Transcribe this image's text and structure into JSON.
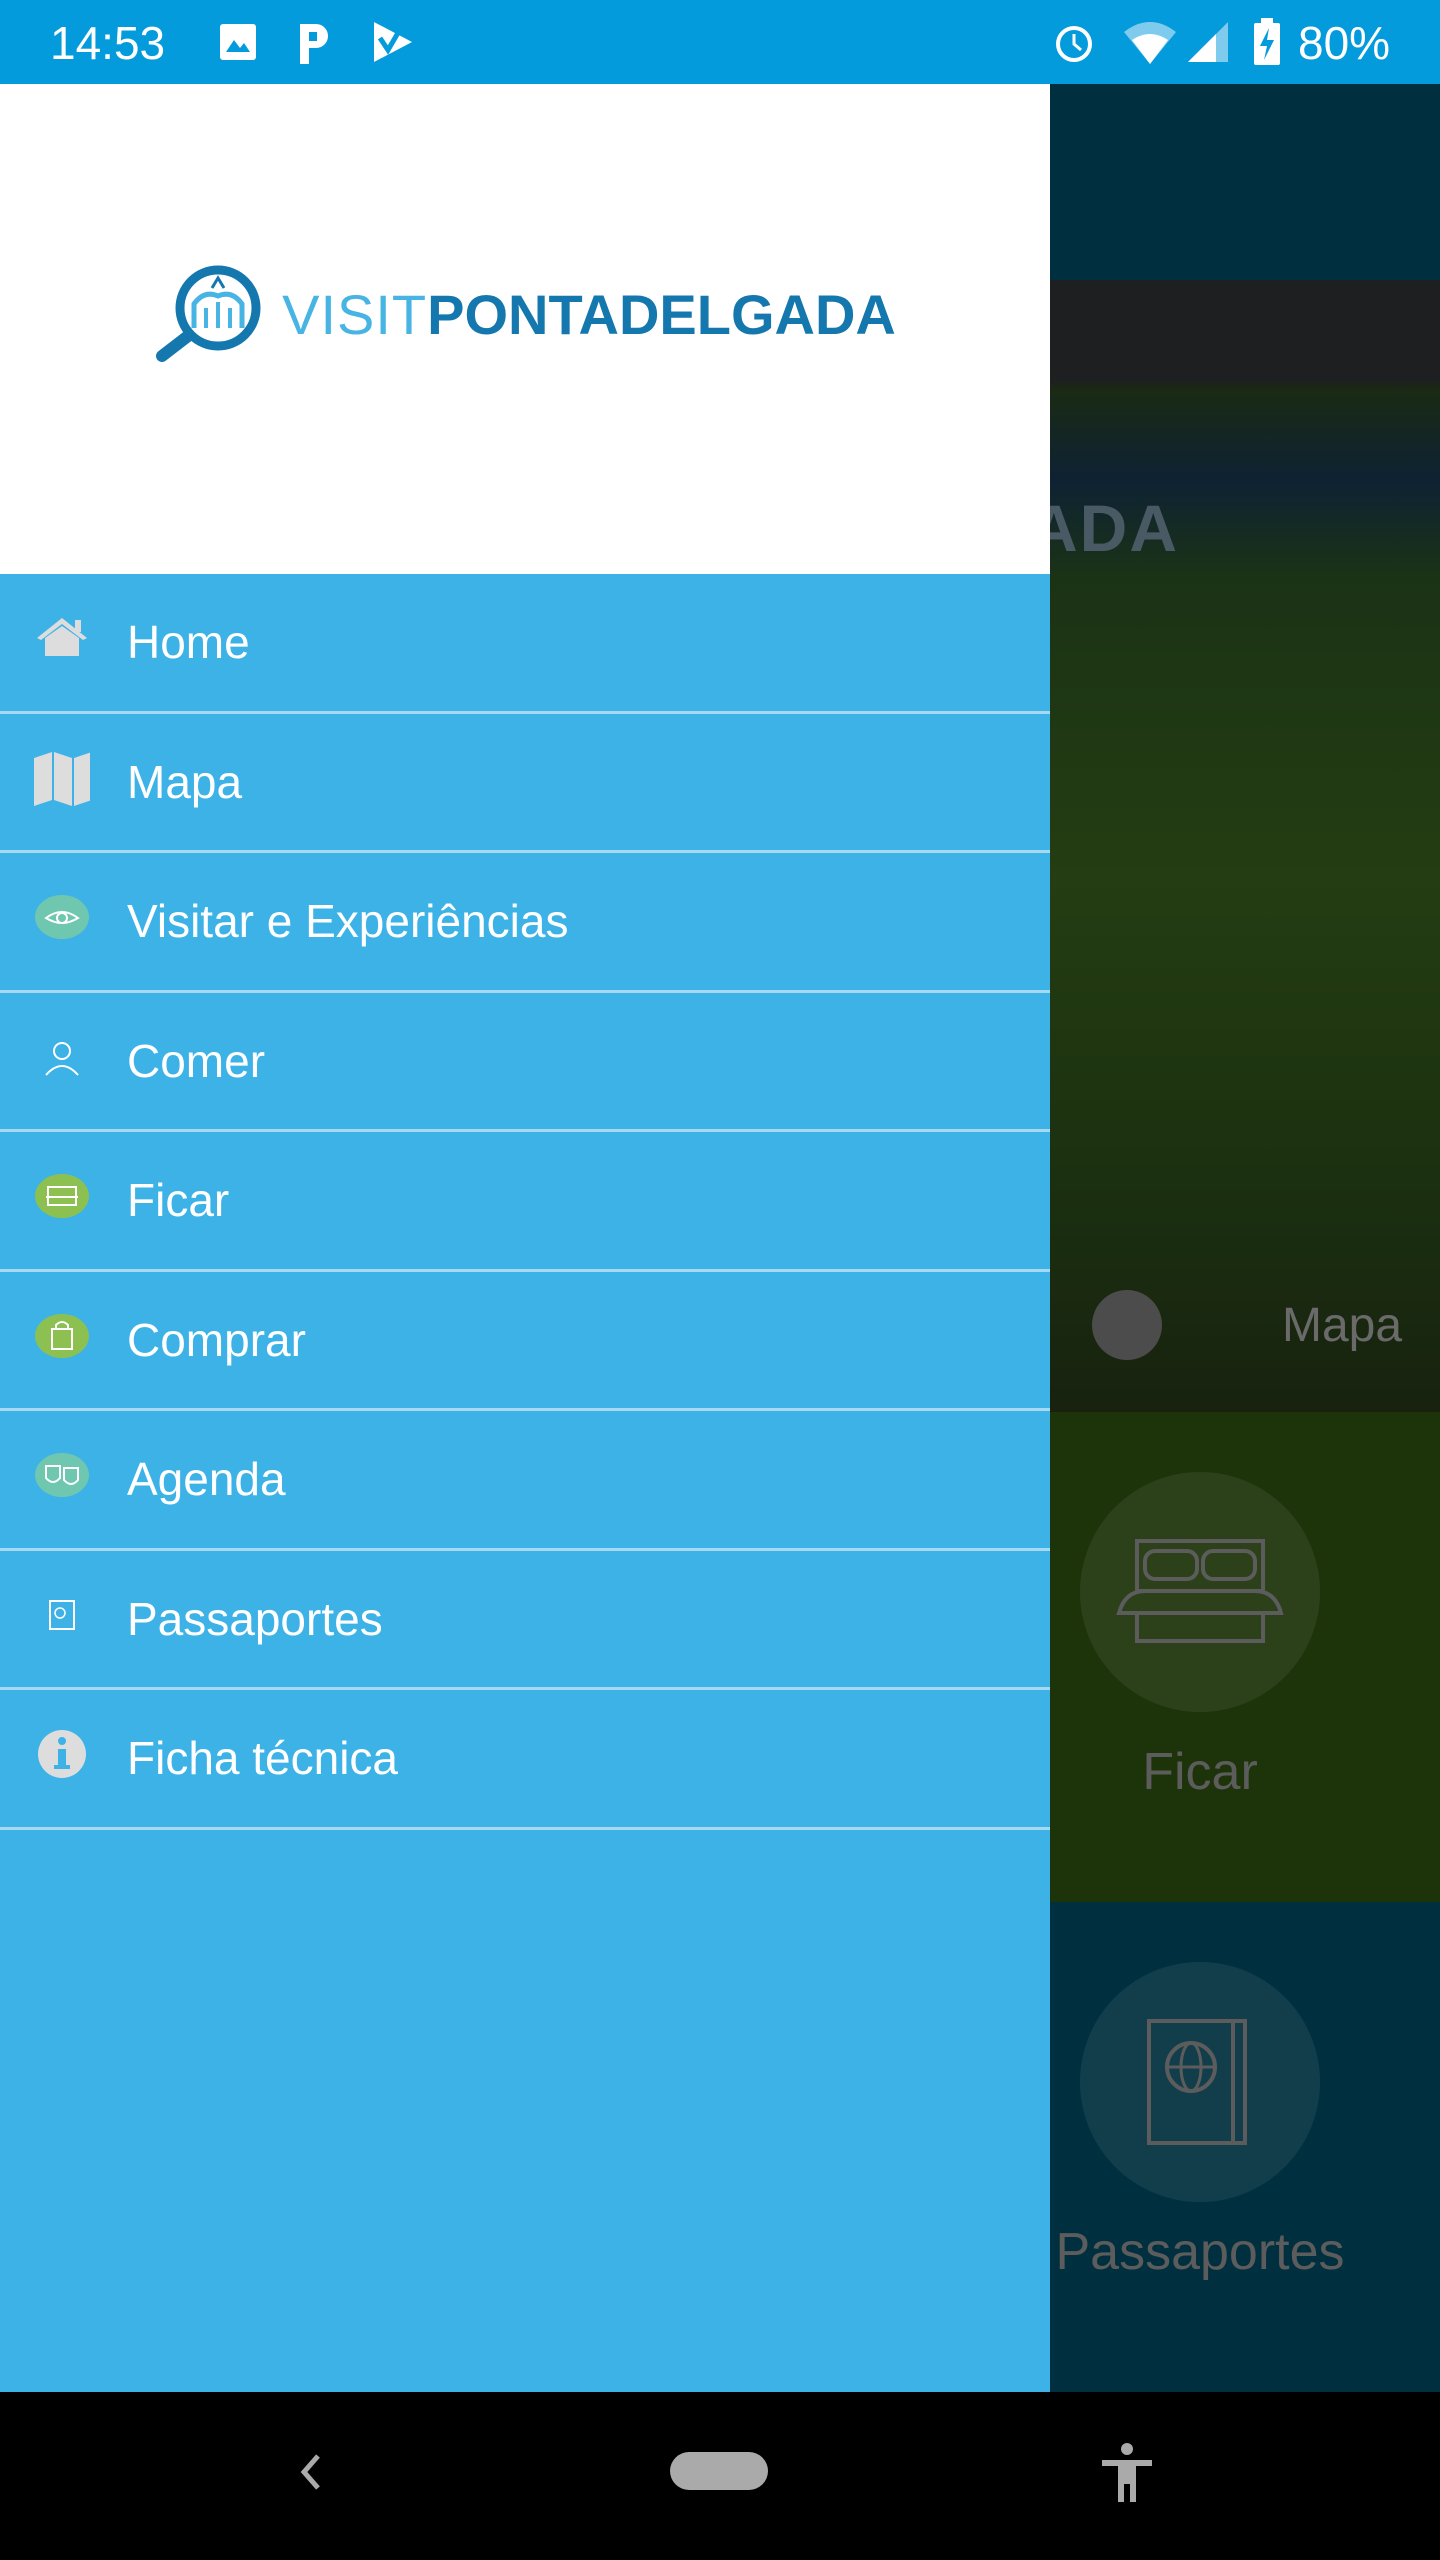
{
  "status_bar": {
    "time": "14:53",
    "battery": "80%",
    "icons": [
      "image-icon",
      "parking-icon",
      "check-icon",
      "alarm-icon",
      "wifi-icon",
      "signal-icon",
      "battery-charging-icon"
    ]
  },
  "drawer": {
    "logo": {
      "light": "VISIT",
      "bold": "PONTADELGADA"
    },
    "items": [
      {
        "label": "Home",
        "icon": "home-icon"
      },
      {
        "label": "Mapa",
        "icon": "map-icon"
      },
      {
        "label": "Visitar e Experiências",
        "icon": "eye-icon"
      },
      {
        "label": "Comer",
        "icon": "chef-icon"
      },
      {
        "label": "Ficar",
        "icon": "bed-icon"
      },
      {
        "label": "Comprar",
        "icon": "shopping-bag-icon"
      },
      {
        "label": "Agenda",
        "icon": "theater-masks-icon"
      },
      {
        "label": "Passaportes",
        "icon": "passport-icon"
      },
      {
        "label": "Ficha técnica",
        "icon": "info-icon"
      }
    ]
  },
  "background": {
    "hero_title": "ADA",
    "hero_link": "Mapa",
    "tiles": [
      "Ficar",
      "Passaportes"
    ]
  },
  "colors": {
    "status_bar": "#039bdc",
    "drawer": "#3db2e7",
    "teal_badge": "#6fc7b0",
    "green_badge": "#8cc152"
  }
}
